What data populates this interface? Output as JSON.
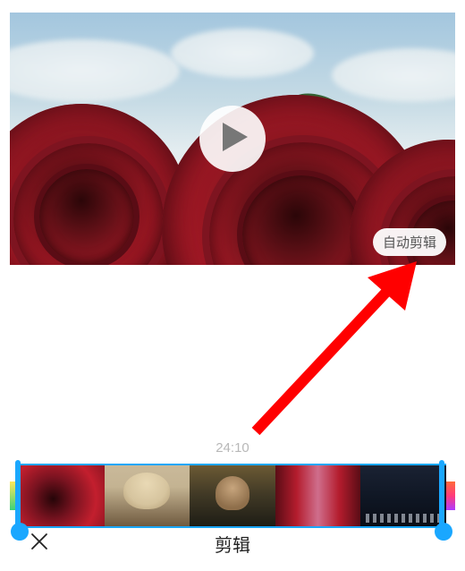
{
  "preview": {
    "auto_edit_label": "自动剪辑",
    "play_icon": "play-icon"
  },
  "timeline": {
    "duration": "24:10"
  },
  "bottom_bar": {
    "close_icon": "close-icon",
    "title": "剪辑"
  },
  "annotation": {
    "arrow_color": "#ff0000"
  }
}
